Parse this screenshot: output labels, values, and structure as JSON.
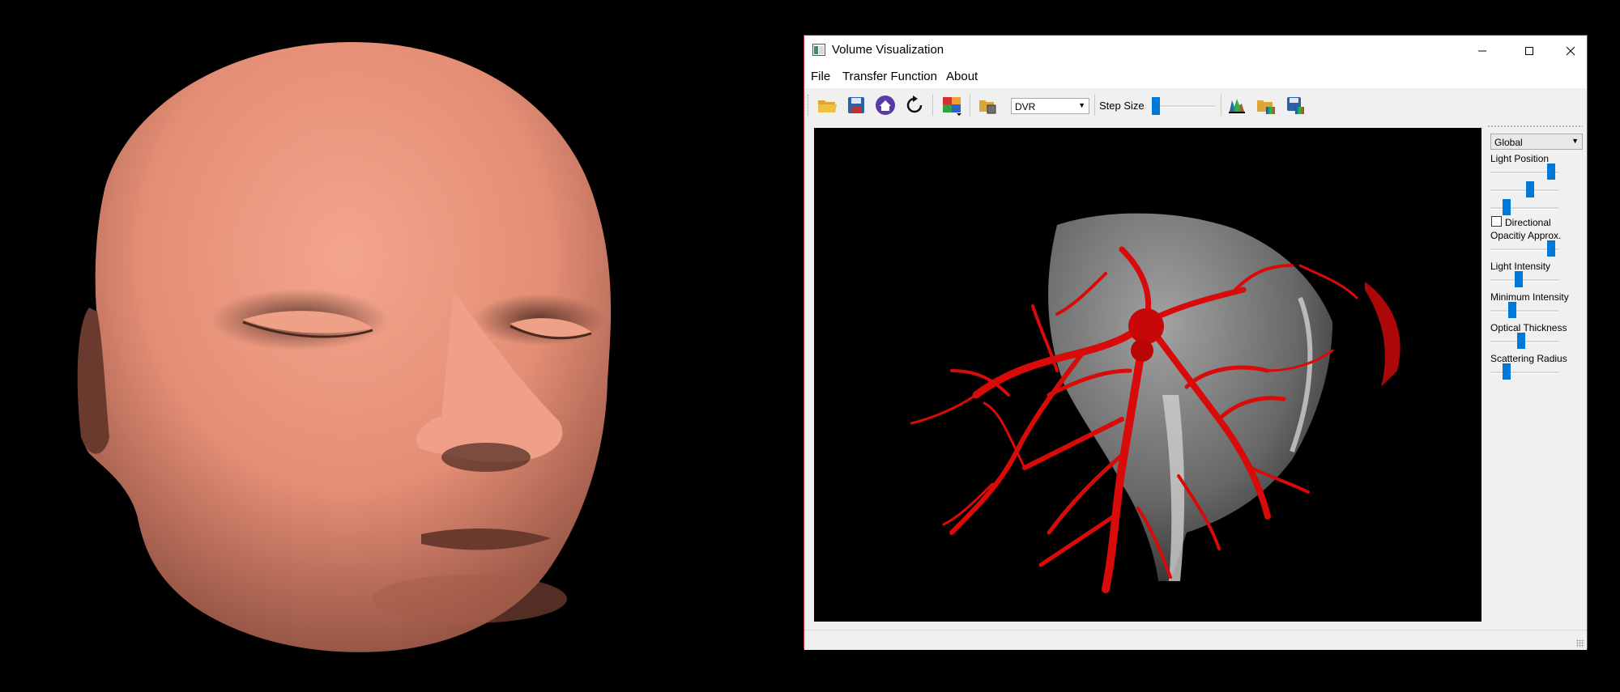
{
  "window": {
    "title": "Volume Visualization",
    "controls": {
      "minimize": "minimize-icon",
      "maximize": "maximize-icon",
      "close": "close-icon"
    }
  },
  "menu": {
    "items": [
      "File",
      "Transfer Function",
      "About"
    ]
  },
  "toolbar": {
    "icons": [
      "open-folder-icon",
      "save-icon",
      "home-icon",
      "rotate-icon",
      "color-map-icon",
      "load-volume-icon",
      "histogram-icon",
      "open-transfer-function-icon",
      "save-transfer-function-icon"
    ],
    "mode_select": {
      "value": "DVR"
    },
    "step_size": {
      "label": "Step Size",
      "value": 0.0
    }
  },
  "panel": {
    "scope_select": {
      "value": "Global"
    },
    "light_position": {
      "label": "Light Position",
      "values": [
        0.95,
        0.6,
        0.2
      ]
    },
    "directional": {
      "label": "Directional",
      "checked": false
    },
    "opacity_approx": {
      "label": "Opacitiy Approx.",
      "value": 0.95
    },
    "light_intensity": {
      "label": "Light Intensity",
      "value": 0.4
    },
    "minimum_intensity": {
      "label": "Minimum Intensity",
      "value": 0.3
    },
    "optical_thickness": {
      "label": "Optical Thickness",
      "value": 0.45
    },
    "scattering_radius": {
      "label": "Scattering Radius",
      "value": 0.2
    }
  },
  "colors": {
    "accent": "#0078d7",
    "window_border": "#c8283c",
    "face": "#e8937a",
    "vessels": "#d80a0a"
  }
}
